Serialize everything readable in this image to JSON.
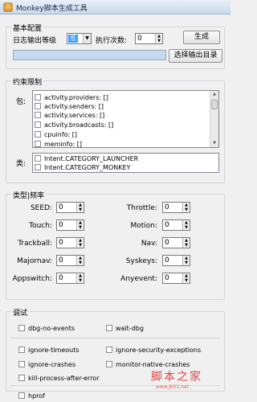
{
  "window": {
    "title": "Monkey脚本生成工具"
  },
  "basic": {
    "group_title": "基本配置",
    "log_level_label": "日志输出等级",
    "log_level_value": "低",
    "exec_count_label": "执行次数:",
    "exec_count_value": "0",
    "generate_button": "生成",
    "output_dir_button": "选择输出目录"
  },
  "constraints": {
    "group_title": "约束限制",
    "package_label": "包:",
    "packages": [
      "activity.providers: []",
      "activity.senders: []",
      "activity.services: []",
      "activity.broadcasts: []",
      "cpuinfo: []",
      "meminfo: []"
    ],
    "category_label": "类:",
    "categories": [
      "Intent.CATEGORY_LAUNCHER",
      "Intent.CATEGORY_MONKEY"
    ]
  },
  "frequency": {
    "group_title": "类型|频率",
    "fields": [
      {
        "label": "SEED:",
        "value": "0"
      },
      {
        "label": "Throttle:",
        "value": "0"
      },
      {
        "label": "Touch:",
        "value": "0"
      },
      {
        "label": "Motion:",
        "value": "0"
      },
      {
        "label": "Trackball:",
        "value": "0"
      },
      {
        "label": "Nav:",
        "value": "0"
      },
      {
        "label": "Majornav:",
        "value": "0"
      },
      {
        "label": "Syskeys:",
        "value": "0"
      },
      {
        "label": "Appswitch:",
        "value": "0"
      },
      {
        "label": "Anyevent:",
        "value": "0"
      }
    ]
  },
  "debug": {
    "group_title": "调试",
    "options": [
      "dbg-no-events",
      "wait-dbg",
      "ignore-timeouts",
      "ignore-security-exceptions",
      "ignore-crashes",
      "monitor-native-crashes",
      "kill-process-after-error",
      "hprof"
    ]
  },
  "watermark": {
    "main": "脚本之家",
    "sub": "www.jb51.net"
  }
}
